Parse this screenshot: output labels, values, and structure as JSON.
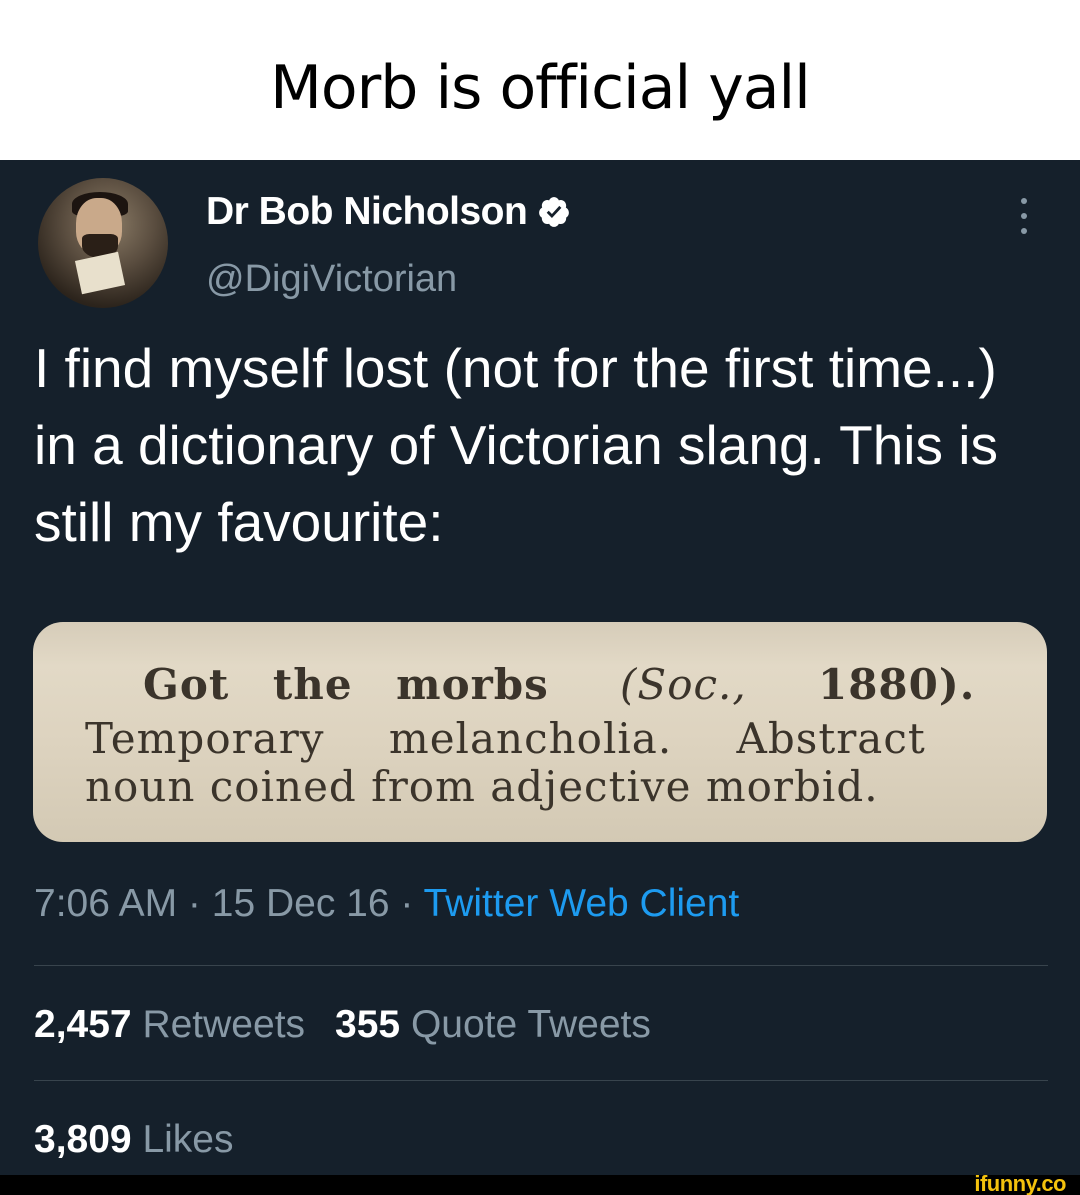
{
  "caption": {
    "text": "Morb is official yall"
  },
  "tweet": {
    "author": {
      "display_name": "Dr Bob Nicholson",
      "handle": "@DigiVictorian",
      "verified": true,
      "avatar_icon": "profile-photo"
    },
    "text": "I find myself lost (not for the first time...) in a dictionary of Victorian slang. This is still my favourite:",
    "image": {
      "line1": {
        "term": "Got the morbs",
        "source": "Soc.,",
        "year": "1880)."
      },
      "line1_open_paren": "(",
      "line2": "Temporary melancholia. Abstract",
      "line3": "noun coined from adjective morbid."
    },
    "meta": {
      "time": "7:06 AM",
      "separator": " · ",
      "date": "15 Dec 16",
      "client": "Twitter Web Client"
    },
    "stats": {
      "retweets_count": "2,457",
      "retweets_label": "Retweets",
      "quotes_count": "355",
      "quotes_label": "Quote Tweets",
      "likes_count": "3,809",
      "likes_label": "Likes"
    }
  },
  "watermark": {
    "text": "ifunny.co"
  },
  "colors": {
    "background": "#15202b",
    "text": "#ffffff",
    "secondary": "#8899a6",
    "accent": "#1d9bf0",
    "divider": "#38444d",
    "watermark": "#f4c20d"
  }
}
